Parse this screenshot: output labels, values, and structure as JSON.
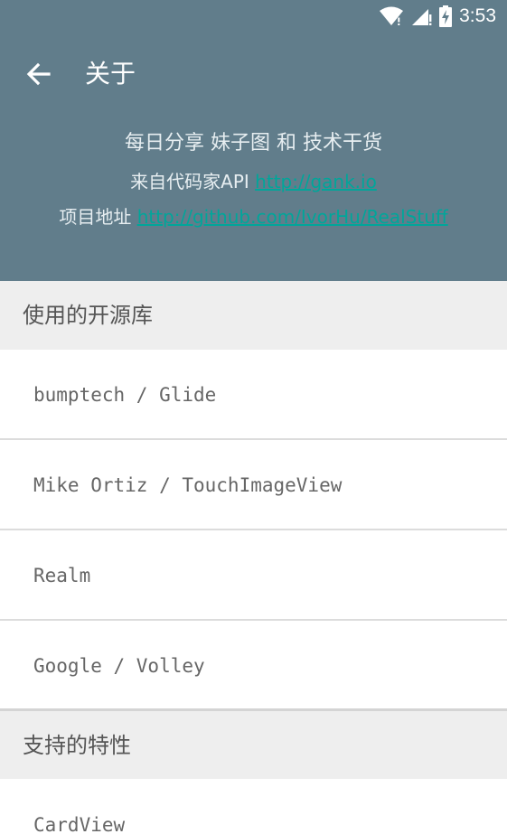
{
  "status_bar": {
    "time": "3:53",
    "icons": [
      "wifi-icon",
      "cell-signal-icon",
      "battery-charging-icon"
    ]
  },
  "toolbar": {
    "back_icon": "arrow-left-icon",
    "title": "关于"
  },
  "about": {
    "tagline": "每日分享 妹子图 和 技术干货",
    "api_prefix": "来自代码家API ",
    "api_link": "http://gank.io",
    "project_prefix": "项目地址 ",
    "project_link": "http://github.com/IvorHu/RealStuff"
  },
  "sections": {
    "libraries": {
      "title": "使用的开源库",
      "items": [
        "bumptech / Glide",
        "Mike Ortiz / TouchImageView",
        "Realm",
        "Google / Volley"
      ]
    },
    "features": {
      "title": "支持的特性",
      "items": [
        "CardView"
      ]
    }
  },
  "colors": {
    "header_bg": "#617d8b",
    "link": "#00a69a",
    "section_bg": "#eeeeee"
  }
}
